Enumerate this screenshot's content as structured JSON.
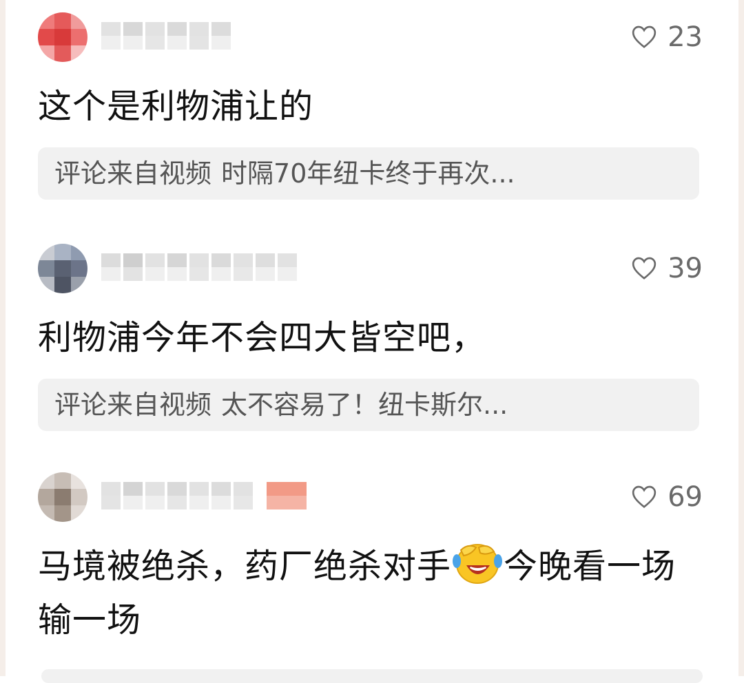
{
  "comments": [
    {
      "likes": "23",
      "text": "这个是利物浦让的",
      "ref_prefix": "评论来自视频",
      "ref_title": "时隔70年纽卡终于再次..."
    },
    {
      "likes": "39",
      "text": "利物浦今年不会四大皆空吧，",
      "ref_prefix": "评论来自视频",
      "ref_title": "太不容易了！纽卡斯尔..."
    },
    {
      "likes": "69",
      "text_part1": "马境被绝杀，药厂绝杀对手",
      "emoji": "laughing-crying-emoji",
      "text_part2": "今晚看一场输一场"
    }
  ],
  "icons": {
    "like": "heart-outline-icon"
  },
  "colors": {
    "like_count": "#6a6a6a",
    "reference_bg": "#f1f1f1",
    "text": "#111111"
  }
}
